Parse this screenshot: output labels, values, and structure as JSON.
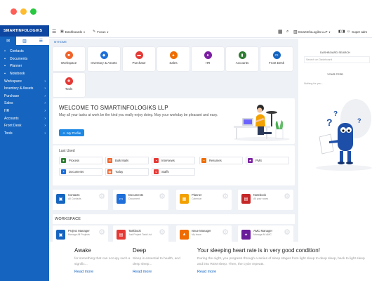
{
  "app": {
    "brand": "SMARTINFOLOGIKS LLP"
  },
  "sidebar": {
    "tabs": [
      {
        "icon": "envelope-icon"
      },
      {
        "icon": "chart-icon"
      },
      {
        "icon": "users-icon"
      }
    ],
    "items": [
      {
        "label": "Contacts",
        "icon": "contacts-icon"
      },
      {
        "label": "Documents",
        "icon": "documents-icon"
      },
      {
        "label": "Planner",
        "icon": "calendar-icon"
      },
      {
        "label": "Notebook",
        "icon": "notebook-icon"
      },
      {
        "label": "Workspace"
      },
      {
        "label": "Inventory & Assets"
      },
      {
        "label": "Purchase"
      },
      {
        "label": "Sales"
      },
      {
        "label": "HR"
      },
      {
        "label": "Accounts"
      },
      {
        "label": "Front Desk"
      },
      {
        "label": "Tools"
      }
    ]
  },
  "topbar": {
    "dashboards": "Dashboards",
    "focus": "Focus",
    "company": "SmartInfoLogiks LLP",
    "user": "Super adm"
  },
  "main": {
    "breadcrumb": "MYHOME",
    "modules": [
      {
        "label": "Workspace",
        "color": "#f0632a",
        "icon": "briefcase-icon"
      },
      {
        "label": "Inventory & Assets",
        "color": "#1e6fd9",
        "icon": "cube-icon"
      },
      {
        "label": "Purchase",
        "color": "#e53935",
        "icon": "cart-icon"
      },
      {
        "label": "Sales",
        "color": "#ef6c00",
        "icon": "tag-icon"
      },
      {
        "label": "HR",
        "color": "#7b1fa2",
        "icon": "people-icon"
      },
      {
        "label": "Accounts",
        "color": "#2e7d32",
        "icon": "ledger-icon"
      },
      {
        "label": "Front Desk",
        "color": "#1565c0",
        "icon": "desk-icon"
      },
      {
        "label": "Tools",
        "color": "#e53935",
        "icon": "wrench-icon"
      }
    ],
    "welcome": {
      "title": "WELCOME TO SMARTINFOLOGIKS LLP",
      "message": "May all your tasks at work be the kind you really enjoy doing. May your workday be pleasant and easy.",
      "button": "My Profile"
    },
    "last_used": {
      "heading": "Last Used",
      "items": [
        {
          "label": "Process",
          "color": "#2e7d32"
        },
        {
          "label": "Bulk Mails",
          "color": "#f0632a"
        },
        {
          "label": "Interviews",
          "color": "#e53935"
        },
        {
          "label": "Resumes",
          "color": "#ef6c00"
        },
        {
          "label": "PMS",
          "color": "#7b1fa2"
        },
        {
          "label": "Documents",
          "color": "#1e6fd9"
        },
        {
          "label": "Today",
          "color": "#f0632a"
        },
        {
          "label": "Staffs",
          "color": "#e53935"
        }
      ]
    },
    "quick_cards": [
      {
        "title": "Contacts",
        "sub": "All Contacts",
        "color": "#1565c0"
      },
      {
        "title": "Documents",
        "sub": "Document",
        "color": "#1e6fd9"
      },
      {
        "title": "Planner",
        "sub": "Calendar",
        "color": "#f2a100"
      },
      {
        "title": "Notebook",
        "sub": "All your notes",
        "color": "#c62828"
      }
    ],
    "workspace": {
      "heading": "WORKSPACE",
      "cards": [
        {
          "title": "Project Manager",
          "sub": "Manage All Projects",
          "color": "#1565c0"
        },
        {
          "title": "Taskbook",
          "sub": "Just Project Task List",
          "color": "#e53935"
        },
        {
          "title": "Issue Manager",
          "sub": "My Issue",
          "color": "#ef6c00"
        },
        {
          "title": "AMC Manager",
          "sub": "Manage All AMC",
          "color": "#6a1b9a"
        }
      ]
    }
  },
  "right_pane": {
    "search_heading": "DASHBOARD SEARCH",
    "search_placeholder": "Search on Dashboard",
    "feed_heading": "YOUR FEED",
    "feed_status": "Nothing for you..."
  },
  "bottom": [
    {
      "title": "Awake",
      "desc": "for something that can occupy such a signific...",
      "link": "Read more"
    },
    {
      "title": "Deep",
      "desc": "Sleep is essential to health, and deep sleep...",
      "link": "Read more"
    },
    {
      "title": "Your sleeping heart rate is in very good condition!",
      "desc": "During the night, you progress through a series of sleep stages from light sleep to deep sleep, back to light sleep and into REM sleep. Then, the cycle repeats.",
      "link": "Read more"
    }
  ]
}
